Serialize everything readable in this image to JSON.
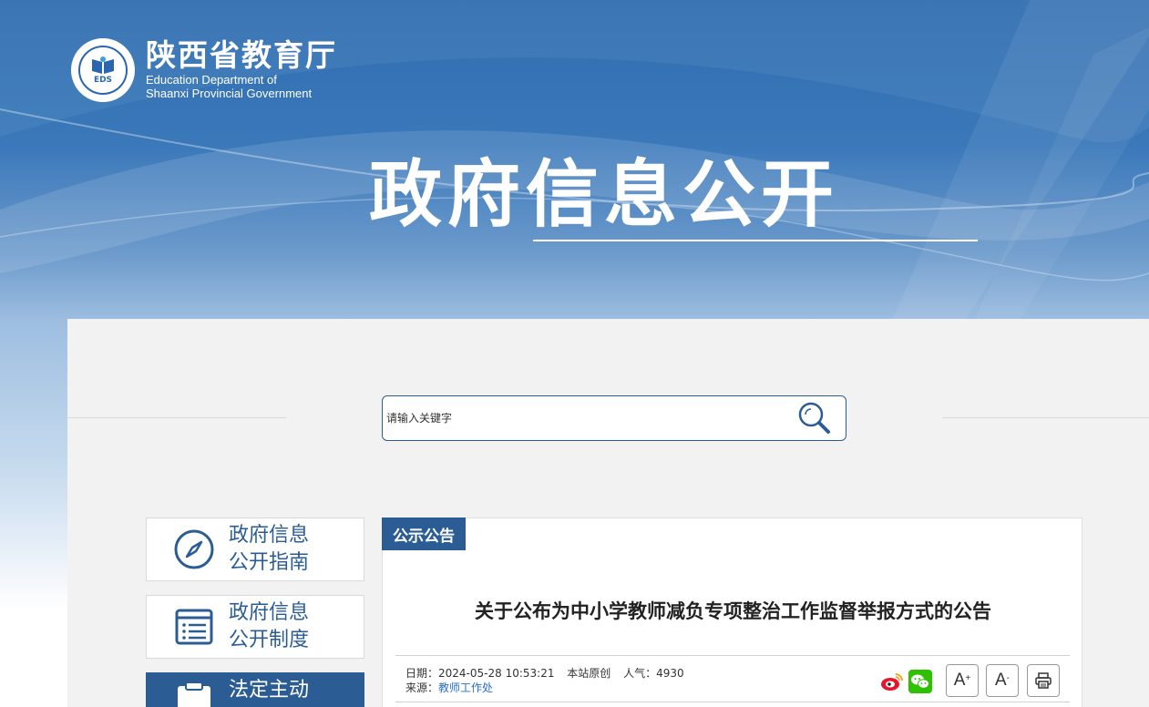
{
  "header": {
    "org_name_cn": "陕西省教育厅",
    "org_name_en_line1": "Education Department of",
    "org_name_en_line2": "Shaanxi Provincial Government",
    "emblem_text": "EDS",
    "banner_title": "政府信息公开"
  },
  "search": {
    "placeholder": "请输入关键字",
    "icon": "search-icon"
  },
  "sidebar": {
    "items": [
      {
        "label_line1": "政府信息",
        "label_line2": "公开指南",
        "icon": "compass-icon",
        "active": false
      },
      {
        "label_line1": "政府信息",
        "label_line2": "公开制度",
        "icon": "document-list-icon",
        "active": false
      },
      {
        "label_line1": "法定主动",
        "label_line2": "",
        "icon": "clipboard-icon",
        "active": true
      }
    ]
  },
  "article": {
    "category_tag": "公示公告",
    "title": "关于公布为中小学教师减负专项整治工作监督举报方式的公告",
    "date_label": "日期：",
    "date_value": "2024-05-28 10:53:21",
    "origin": "本站原创",
    "views_label": "人气：",
    "views_value": "4930",
    "source_label": "来源：",
    "source_value": "教师工作处"
  },
  "tools": {
    "font_increase": "A",
    "font_increase_mark": "+",
    "font_decrease": "A",
    "font_decrease_mark": "-"
  },
  "colors": {
    "brand_blue": "#2b5d94",
    "link_blue": "#2b6fc4",
    "weibo_red": "#e6162d",
    "wechat_green": "#2dc100"
  }
}
